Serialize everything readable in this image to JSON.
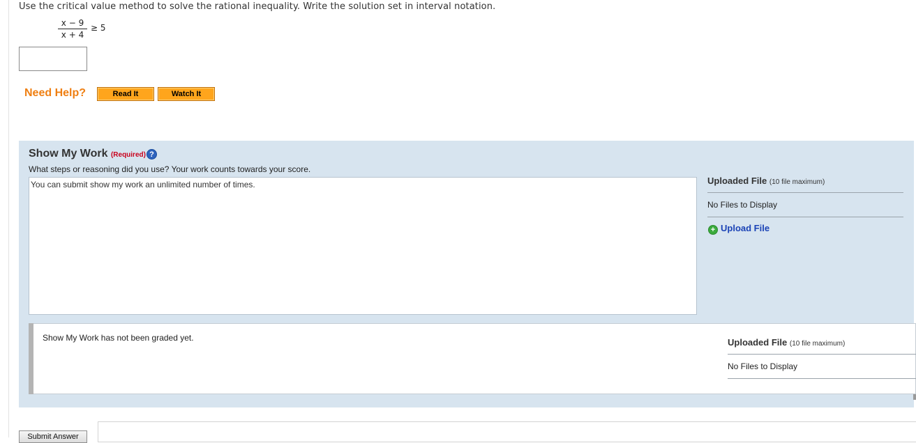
{
  "question": {
    "text": "Use the critical value method to solve the rational inequality. Write the solution set in interval notation.",
    "numerator": "x − 9",
    "denominator": "x + 4",
    "relation": "≥ 5"
  },
  "answer": {
    "value": ""
  },
  "help": {
    "label": "Need Help?",
    "read_it": "Read It",
    "watch_it": "Watch It"
  },
  "show_my_work": {
    "title": "Show My Work",
    "required": "(Required)",
    "help_icon": "?",
    "prompt": "What steps or reasoning did you use? Your work counts towards your score.",
    "textarea_text": "You can submit show my work an unlimited number of times.",
    "uploaded_title": "Uploaded File",
    "uploaded_max": "(10 file maximum)",
    "no_files": "No Files to Display",
    "upload_link": "Upload File",
    "upload_icon": "+",
    "graded_text": "Show My Work has not been graded yet.",
    "graded_uploaded_title": "Uploaded File",
    "graded_uploaded_max": "(10 file maximum)",
    "graded_no_files": "No Files to Display"
  },
  "submit": {
    "label": "Submit Answer"
  },
  "colors": {
    "help_orange": "#ef7f12",
    "button_orange": "#ffa51c",
    "panel_blue": "#d7e4ef",
    "link_blue": "#1b43b6",
    "required_red": "#c8001c"
  },
  "icons": {
    "help": "help-icon",
    "upload": "plus-circle-icon"
  }
}
